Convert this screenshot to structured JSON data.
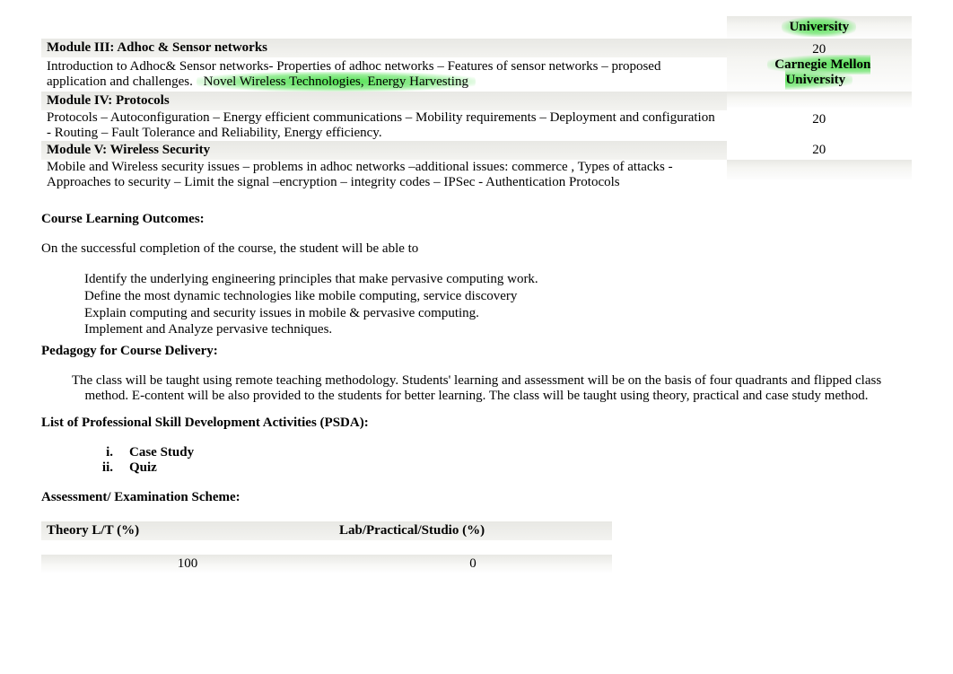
{
  "modules": {
    "header_university": "University",
    "m3": {
      "title": "Module III: Adhoc & Sensor networks",
      "body_before": "Introduction to Adhoc& Sensor networks- Properties of adhoc networks – Features of sensor networks – proposed application and challenges. ",
      "body_highlight": "Novel Wireless Technologies, Energy Harvesting",
      "hours": "20",
      "university": "Carnegie Mellon University"
    },
    "m4": {
      "title": "Module IV: Protocols",
      "body": "Protocols – Autoconfiguration – Energy efficient communications – Mobility requirements – Deployment and configuration - Routing – Fault Tolerance and Reliability, Energy efficiency.",
      "hours": "20"
    },
    "m5": {
      "title": "Module V: Wireless Security",
      "body": "Mobile and Wireless security issues – problems in adhoc networks –additional issues: commerce , Types of attacks - Approaches to security – Limit the signal –encryption – integrity codes – IPSec - Authentication Protocols",
      "hours": "20"
    }
  },
  "outcomes": {
    "heading": "Course Learning Outcomes:",
    "intro": "On the successful completion of the course, the student will be able to",
    "items": [
      "Identify the underlying engineering principles that make pervasive computing work.",
      "Define the most dynamic technologies like mobile computing, service discovery",
      "Explain computing and security issues in mobile & pervasive computing.",
      "Implement and Analyze pervasive techniques.",
      ""
    ]
  },
  "pedagogy": {
    "heading": "Pedagogy for Course Delivery:",
    "body": "The class will be taught using remote teaching methodology. Students' learning and assessment will be on the basis of four quadrants and flipped class method. E-content will be also provided to the students for better learning. The class will be taught using theory, practical and case study method."
  },
  "psda": {
    "heading": "List of Professional Skill Development Activities (PSDA):",
    "items": [
      {
        "num": "i.",
        "label": "Case Study"
      },
      {
        "num": "ii.",
        "label": "Quiz"
      }
    ]
  },
  "assessment": {
    "heading": "Assessment/ Examination Scheme:",
    "col1_header": "Theory L/T (%)",
    "col2_header": "Lab/Practical/Studio (%)",
    "col1_value": "100",
    "col2_value": "0"
  }
}
